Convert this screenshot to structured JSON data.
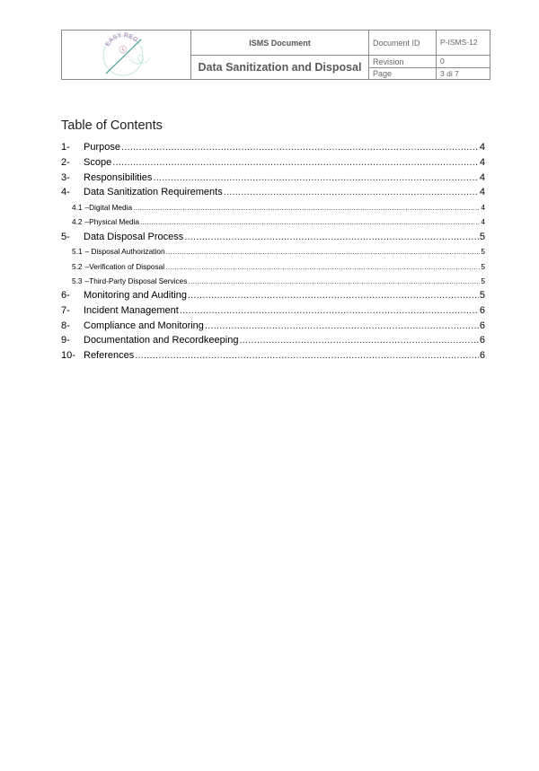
{
  "header": {
    "logo_text": "EASY REG",
    "doc_type": "ISMS Document",
    "doc_title": "Data Sanitization and Disposal",
    "document_id_label": "Document ID",
    "document_id_value": "P-ISMS-12",
    "revision_label": "Revision",
    "revision_value": "0",
    "page_label": "Page",
    "page_value": "3 di 7"
  },
  "toc": {
    "title": "Table of Contents",
    "entries": [
      {
        "num": "1-",
        "text": "Purpose",
        "page": "4",
        "level": 1
      },
      {
        "num": "2-",
        "text": "Scope",
        "page": "4",
        "level": 1
      },
      {
        "num": "3-",
        "text": "Responsibilities",
        "page": "4",
        "level": 1
      },
      {
        "num": "4-",
        "text": "Data Sanitization Requirements",
        "page": "4",
        "level": 1
      },
      {
        "num": "4.1",
        "text": "–Digital Media",
        "page": "4",
        "level": 2
      },
      {
        "num": "4.2",
        "text": " –Physical Media",
        "page": "4",
        "level": 2
      },
      {
        "num": "5-",
        "text": "Data Disposal Process",
        "page": "5",
        "level": 1
      },
      {
        "num": "5.1",
        "text": " – Disposal Authorization",
        "page": "5",
        "level": 2
      },
      {
        "num": "5.2",
        "text": " –Verification of Disposal",
        "page": "5",
        "level": 2
      },
      {
        "num": "5.3",
        "text": " –Third-Party Disposal Services",
        "page": "5",
        "level": 2
      },
      {
        "num": "6-",
        "text": "Monitoring and Auditing",
        "page": "5",
        "level": 1
      },
      {
        "num": "7-",
        "text": "Incident Management",
        "page": "6",
        "level": 1
      },
      {
        "num": "8-",
        "text": "Compliance and Monitoring",
        "page": "6",
        "level": 1
      },
      {
        "num": "9-",
        "text": "Documentation and Recordkeeping",
        "page": "6",
        "level": 1
      },
      {
        "num": "10-",
        "text": "References",
        "page": "6",
        "level": 1
      }
    ]
  }
}
